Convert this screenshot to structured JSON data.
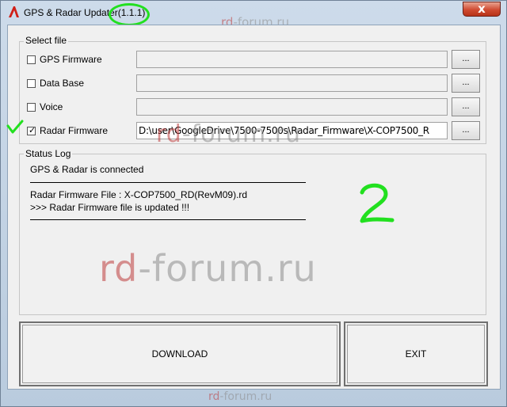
{
  "window": {
    "title": "GPS & Radar Updater(1.1.1)",
    "close_glyph": "x"
  },
  "select_file": {
    "legend": "Select file",
    "items": [
      {
        "label": "GPS Firmware",
        "checked": false,
        "path": "",
        "browse": "..."
      },
      {
        "label": "Data Base",
        "checked": false,
        "path": "",
        "browse": "..."
      },
      {
        "label": "Voice",
        "checked": false,
        "path": "",
        "browse": "..."
      },
      {
        "label": "Radar Firmware",
        "checked": true,
        "path": "D:\\user\\GoogleDrive\\7500-7500s\\Radar_Firmware\\X-COP7500_R",
        "browse": "..."
      }
    ]
  },
  "status_log": {
    "legend": "Status Log",
    "line1": "GPS & Radar is connected",
    "line2": "Radar Firmware File   : X-COP7500_RD(RevM09).rd",
    "line3": ">>> Radar Firmware file is updated !!!"
  },
  "buttons": {
    "download": "DOWNLOAD",
    "exit": "EXIT"
  },
  "watermarks": {
    "rd": "rd",
    "rest": "-forum.ru"
  },
  "colors": {
    "annotation_green": "#22e01f",
    "close_red": "#c94330"
  }
}
